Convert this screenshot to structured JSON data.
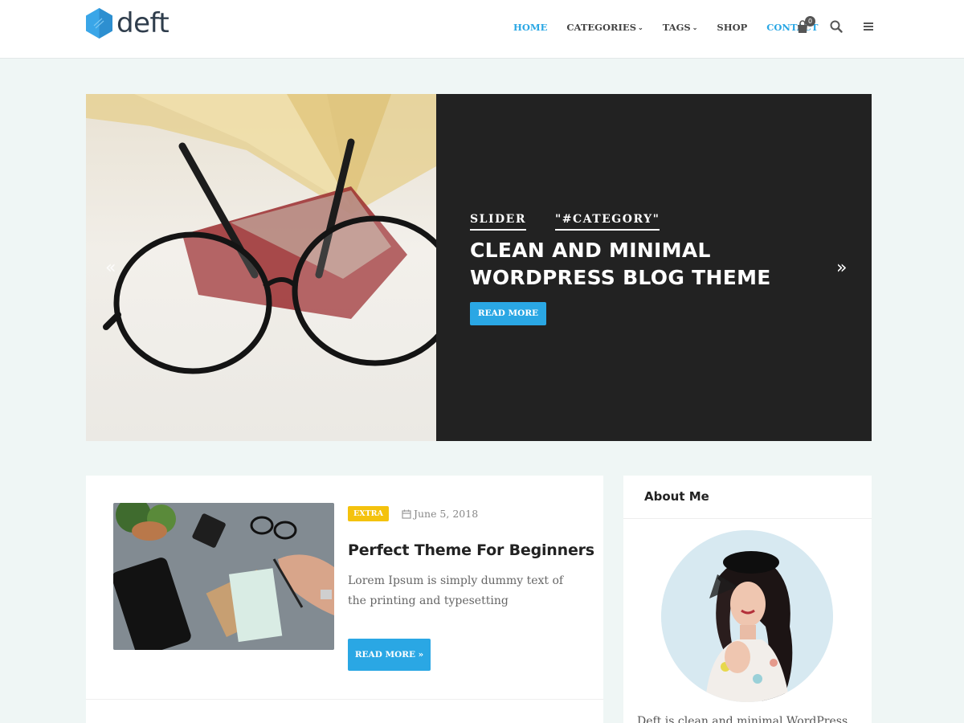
{
  "header": {
    "logo_text": "deft",
    "nav": [
      {
        "label": "HOME",
        "active": true,
        "dropdown": false
      },
      {
        "label": "CATEGORIES",
        "active": false,
        "dropdown": true
      },
      {
        "label": "TAGS",
        "active": false,
        "dropdown": true
      },
      {
        "label": "SHOP",
        "active": false,
        "dropdown": false
      },
      {
        "label": "CONTACT",
        "active": true,
        "dropdown": false
      }
    ],
    "cart_count": "0",
    "icons": [
      "shopping-bag-icon",
      "search-icon",
      "menu-icon"
    ]
  },
  "slider": {
    "tags": [
      "SLIDER",
      "\"#CATEGORY\""
    ],
    "title": "CLEAN AND MINIMAL WORDPRESS BLOG THEME",
    "button_label": "READ MORE",
    "prev_icon": "«",
    "next_icon": "»"
  },
  "post": {
    "category": "EXTRA",
    "date": "June 5, 2018",
    "title": "Perfect Theme For Beginners",
    "excerpt": "Lorem Ipsum  is simply dummy text of the printing and typesetting",
    "button_label": "READ MORE »"
  },
  "sidebar": {
    "widget_title": "About Me",
    "text": "Deft is clean and minimal WordPress"
  },
  "colors": {
    "accent": "#2aa7e4",
    "badge_yellow": "#f4c20d",
    "page_bg": "#eff6f5",
    "slide_dark": "#222222"
  }
}
